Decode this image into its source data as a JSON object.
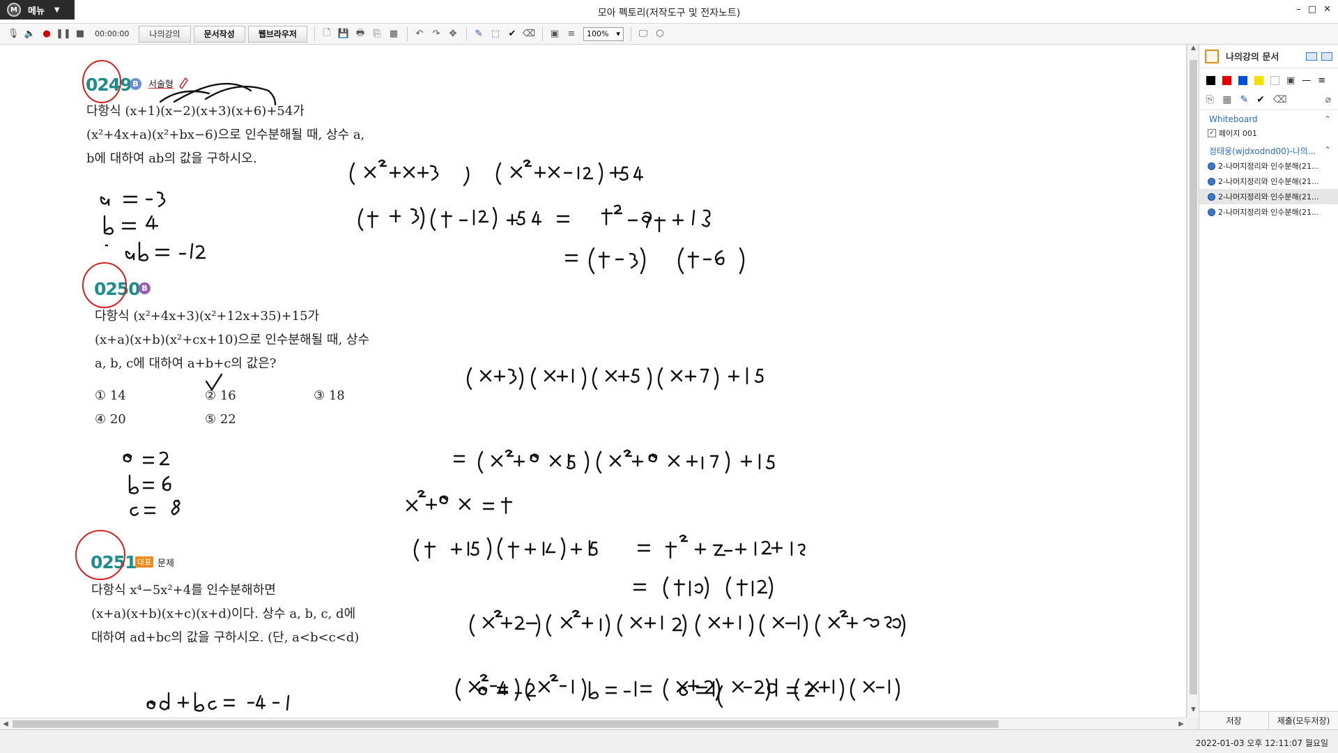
{
  "titlebar": {
    "menu_label": "메뉴",
    "title": "모아 펙토리(저작도구 및 전자노트)",
    "controls": [
      "–",
      "□",
      "✕"
    ]
  },
  "toolbar": {
    "time": "00:00:00",
    "tabs": [
      "나의강의",
      "문서작성",
      "웹브라우저"
    ],
    "zoom": "100%"
  },
  "problems": {
    "p249": {
      "number": "0249",
      "badge": "B",
      "tag": "서술형",
      "lines": [
        "다항식 (x+1)(x−2)(x+3)(x+6)+54가",
        "(x²+4x+a)(x²+bx−6)으로 인수분해될 때, 상수 a,",
        "b에 대하여 ab의 값을 구하시오."
      ]
    },
    "p250": {
      "number": "0250",
      "badge": "B",
      "lines": [
        "다항식 (x²+4x+3)(x²+12x+35)+15가",
        "(x+a)(x+b)(x²+cx+10)으로 인수분해될 때, 상수",
        "a, b, c에 대하여 a+b+c의 값은?"
      ],
      "choices": [
        "① 14",
        "② 16",
        "③ 18",
        "④ 20",
        "⑤ 22"
      ]
    },
    "p251": {
      "number": "0251",
      "tag_box": "대표",
      "tag": "문제",
      "lines": [
        "다항식 x⁴−5x²+4를 인수분해하면",
        "(x+a)(x+b)(x+c)(x+d)이다. 상수 a, b, c, d에",
        "대하여 ad+bc의 값을 구하시오. (단, a<b<c<d)"
      ]
    }
  },
  "side_panel": {
    "title": "나의강의 문서",
    "colors": [
      "#000000",
      "#e00000",
      "#0050e0",
      "#f0e000",
      "#ffffff"
    ],
    "whiteboard_label": "Whiteboard",
    "page_item": "페이지 001",
    "user_label": "정태웅(wjdxodnd00)-나의...",
    "doc_items": [
      "2-나머지정리와 인수분해(21...",
      "2-나머지정리와 인수분해(21...",
      "2-나머지정리와 인수분해(21...",
      "2-나머지정리와 인수분해(21..."
    ],
    "save_label": "저장",
    "submit_label": "제출(모두저장)"
  },
  "status": {
    "datetime": "2022-01-03 오후 12:11:07 월요일"
  }
}
